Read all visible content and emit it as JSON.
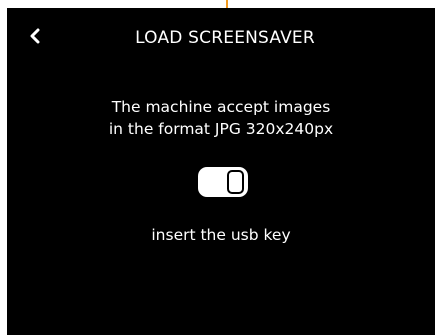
{
  "accent_color": "#f39a1e",
  "header": {
    "back_icon": "chevron-left-icon",
    "title": "LOAD  SCREENSAVER"
  },
  "message": {
    "line1": "The machine accept images",
    "line2": "in the format JPG 320x240px"
  },
  "usb_icon": "usb-key-icon",
  "hint": "insert the usb key"
}
